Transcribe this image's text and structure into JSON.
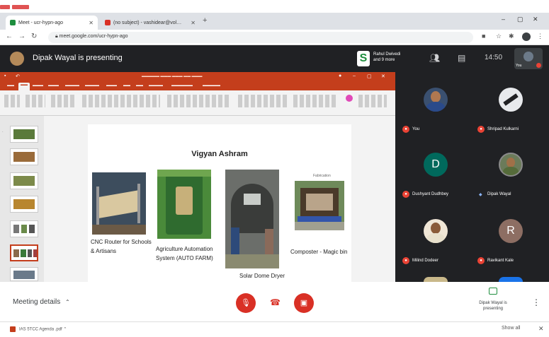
{
  "browser": {
    "tabs": [
      {
        "label": "Meet - ucr-hypn-ago",
        "active": true
      },
      {
        "label": "(no subject) - vashidear@vol…",
        "active": false
      }
    ],
    "url": "meet.google.com/ucr-hypn-ago",
    "new_tab_glyph": "+",
    "window_controls": [
      "–",
      "▢",
      "✕"
    ]
  },
  "meet": {
    "presenting_title": "Dipak Wayal is presenting",
    "speaker_line1": "Rahul Dwivedi",
    "speaker_line2": "and 9 more",
    "clock": "14:50",
    "self_label": "You",
    "participants": [
      {
        "name": "You",
        "initial": "",
        "color": "#5f6368",
        "muted": true
      },
      {
        "name": "Shripad Kulkarni",
        "initial": "",
        "color": "#e8eaed",
        "muted": true
      },
      {
        "name": "Dushyant Dudhbey",
        "initial": "D",
        "color": "#00695c",
        "muted": true
      },
      {
        "name": "Dipak Wayal",
        "initial": "",
        "color": "#6b7b5a",
        "muted": false
      },
      {
        "name": "Milind Dodeer",
        "initial": "",
        "color": "#e0d0b8",
        "muted": true
      },
      {
        "name": "Ravikant Kale",
        "initial": "R",
        "color": "#8d6e63",
        "muted": true
      }
    ],
    "meeting_details_label": "Meeting details",
    "meeting_details_chevron": "⌃",
    "presenting_note": "Dipak Wayal is presenting",
    "kebab": "⋮"
  },
  "slide": {
    "title": "Vigyan Ashram",
    "items": [
      {
        "caption": "CNC Router for Schools & Artisans"
      },
      {
        "caption": "Agriculture Automation System (AUTO FARM)"
      },
      {
        "caption": "Solar Dome Dryer"
      },
      {
        "caption": "Composter - Magic bin",
        "small_label": "Fabrication"
      }
    ]
  },
  "downloads": {
    "file": "IAS 5TCC Agenda .pdf",
    "show_all": "Show all",
    "close": "✕"
  },
  "colors": {
    "meet_dark": "#202124",
    "ppt_red": "#c43e1c",
    "danger": "#d93025",
    "present_green": "#1e8e3e"
  }
}
